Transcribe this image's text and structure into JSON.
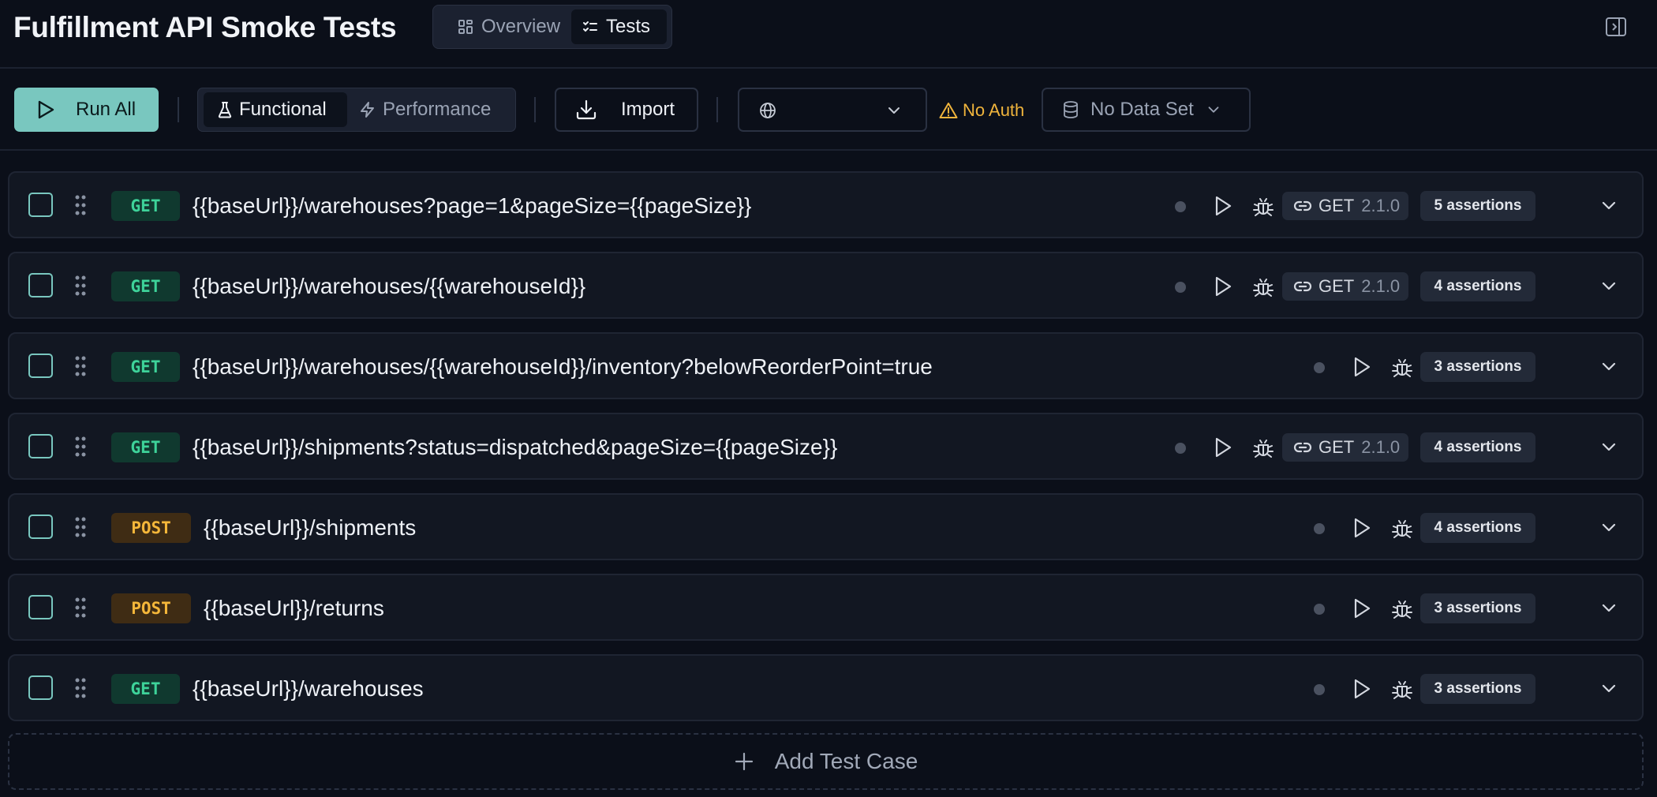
{
  "header": {
    "title": "Fulfillment API Smoke Tests",
    "tabs": [
      {
        "label": "Overview",
        "active": false
      },
      {
        "label": "Tests",
        "active": true
      }
    ]
  },
  "toolbar": {
    "run_all_label": "Run All",
    "mode_tabs": [
      {
        "label": "Functional",
        "active": true
      },
      {
        "label": "Performance",
        "active": false
      }
    ],
    "import_label": "Import",
    "environment_value": "",
    "auth_label": "No Auth",
    "dataset_label": "No Data Set"
  },
  "tests": [
    {
      "method": "GET",
      "url": "{{baseUrl}}/warehouses?page=1&pageSize={{pageSize}}",
      "linked": true,
      "link_method": "GET",
      "link_version": "2.1.0",
      "assertions": "5 assertions"
    },
    {
      "method": "GET",
      "url": "{{baseUrl}}/warehouses/{{warehouseId}}",
      "linked": true,
      "link_method": "GET",
      "link_version": "2.1.0",
      "assertions": "4 assertions"
    },
    {
      "method": "GET",
      "url": "{{baseUrl}}/warehouses/{{warehouseId}}/inventory?belowReorderPoint=true",
      "linked": false,
      "assertions": "3 assertions"
    },
    {
      "method": "GET",
      "url": "{{baseUrl}}/shipments?status=dispatched&pageSize={{pageSize}}",
      "linked": true,
      "link_method": "GET",
      "link_version": "2.1.0",
      "assertions": "4 assertions"
    },
    {
      "method": "POST",
      "url": "{{baseUrl}}/shipments",
      "linked": false,
      "assertions": "4 assertions"
    },
    {
      "method": "POST",
      "url": "{{baseUrl}}/returns",
      "linked": false,
      "assertions": "3 assertions"
    },
    {
      "method": "GET",
      "url": "{{baseUrl}}/warehouses",
      "linked": false,
      "assertions": "3 assertions"
    }
  ],
  "add_case_label": "Add Test Case",
  "colors": {
    "accent": "#79c7bf",
    "get": "#3ed39a",
    "post": "#f5b73a",
    "warning": "#f0b43c",
    "background": "#0b0f19"
  },
  "icons": {
    "overview_tab": "grid-icon",
    "tests_tab": "checklist-icon",
    "run_all": "play-icon",
    "functional": "flask-icon",
    "performance": "lightning-icon",
    "import": "download-icon",
    "environment": "globe-icon",
    "auth": "warning-icon",
    "dataset": "database-icon",
    "panel": "panel-toggle-icon",
    "row_run": "play-icon",
    "row_debug": "bug-icon",
    "row_link": "link-icon",
    "row_expand": "chevron-down-icon",
    "row_drag": "drag-handle-icon",
    "add": "plus-icon"
  }
}
